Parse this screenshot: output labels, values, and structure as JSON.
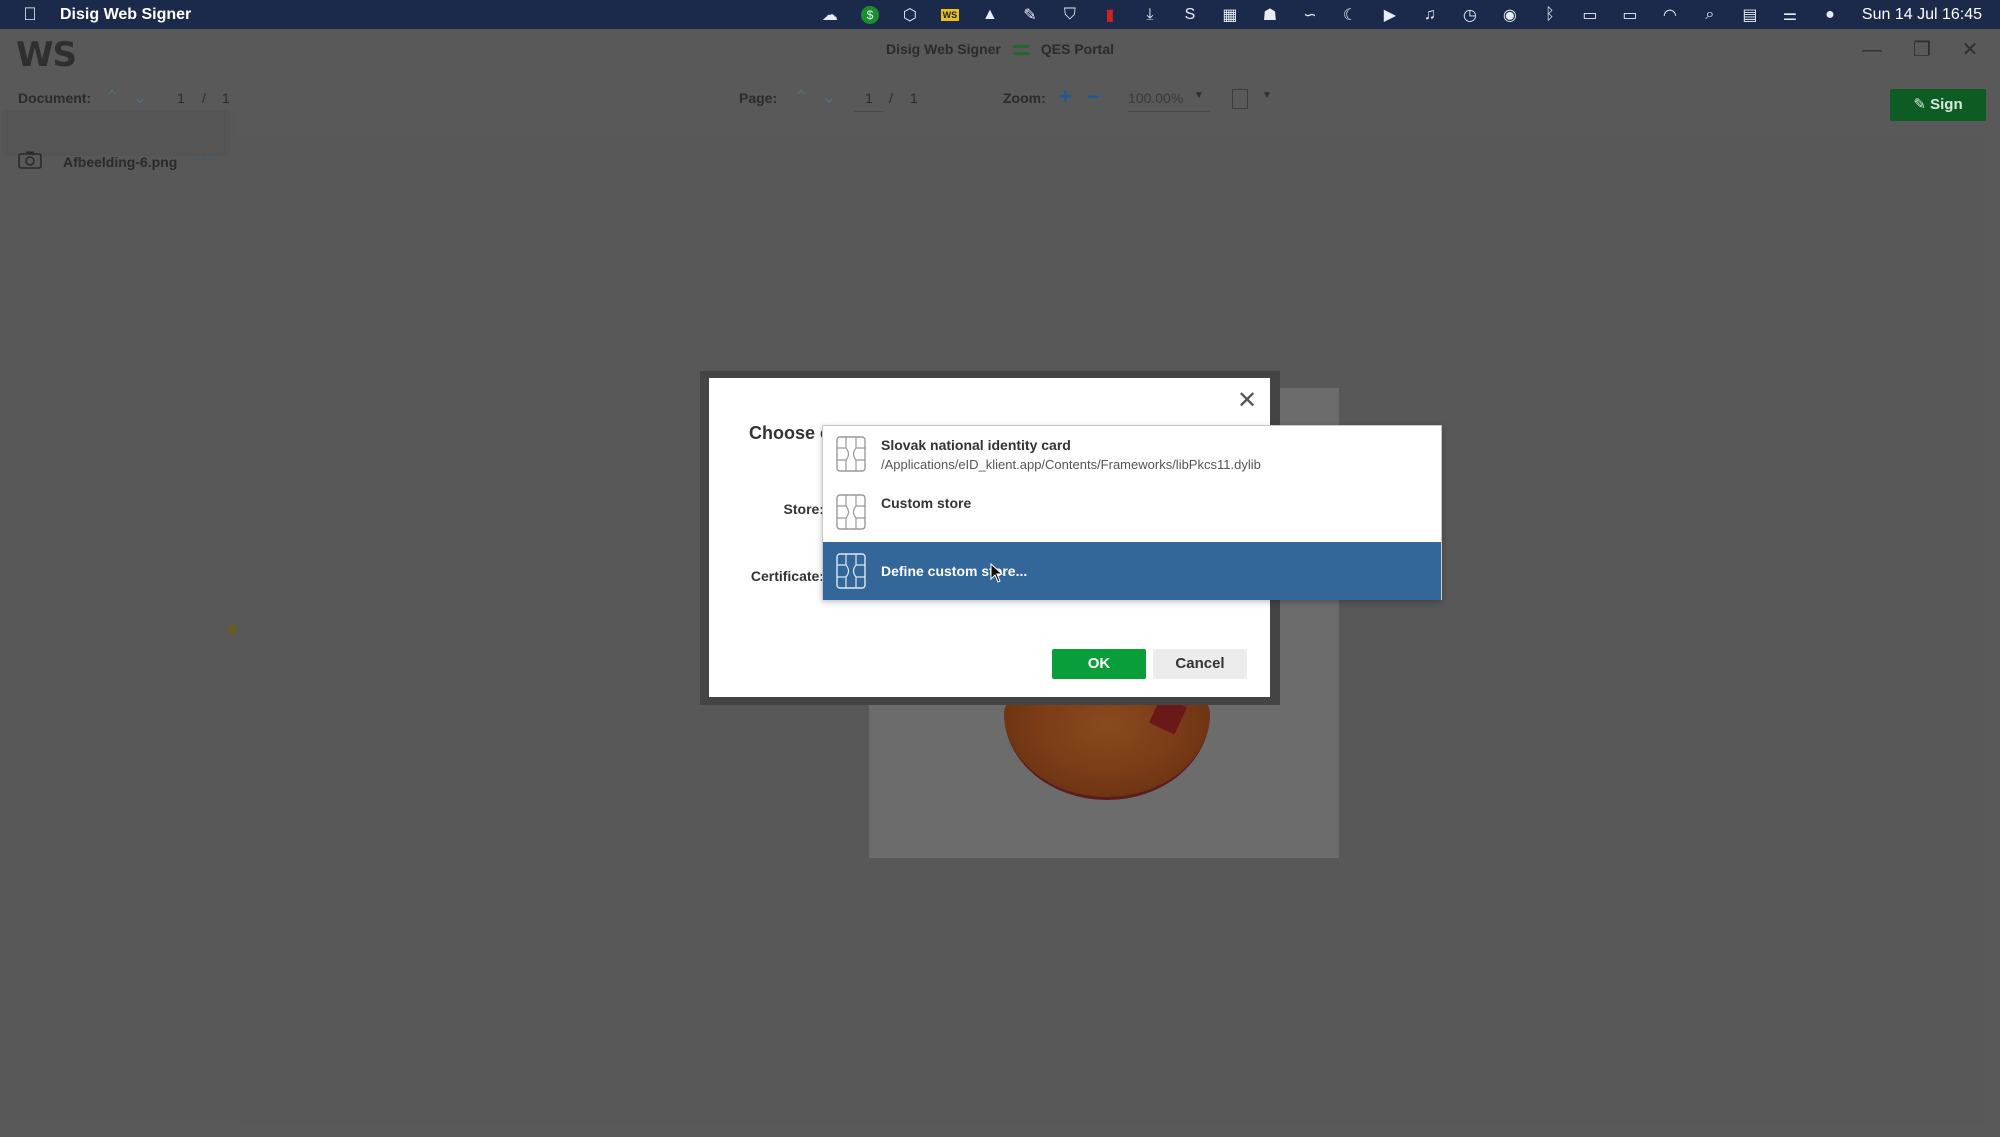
{
  "menubar": {
    "app_name": "Disig Web Signer",
    "clock": "Sun 14 Jul  16:45",
    "tray_icons": [
      "cloud-icon",
      "dollar-icon",
      "box-icon",
      "ws-icon",
      "vlc-icon",
      "pen-icon",
      "shield-icon",
      "book-icon",
      "download-icon",
      "s-icon",
      "grid-icon",
      "hat-icon",
      "signature-icon",
      "moon-icon",
      "play-icon",
      "headphones-icon",
      "history-icon",
      "accessibility-icon",
      "bluetooth-icon",
      "battery-icon",
      "display-icon",
      "wifi-icon",
      "search-icon",
      "keyboard-icon",
      "control-center-icon",
      "siri-icon"
    ]
  },
  "window": {
    "logo": "WS",
    "title_left": "Disig Web Signer",
    "title_right": "QES Portal"
  },
  "toolbar": {
    "document_label": "Document:",
    "document_current": "1",
    "document_sep": "/",
    "document_total": "1",
    "page_label": "Page:",
    "page_current": "1",
    "page_sep": "/",
    "page_total": "1",
    "zoom_label": "Zoom:",
    "zoom_value": "100.00%",
    "sign_label": "Sign"
  },
  "sidebar": {
    "document_name": "Afbeelding-6.png",
    "more": "···"
  },
  "dialog": {
    "title": "Choose c",
    "store_label": "Store:",
    "certificate_label": "Certificate:",
    "ok_label": "OK",
    "cancel_label": "Cancel"
  },
  "dropdown": {
    "items": [
      {
        "name": "Slovak national identity card",
        "path": "/Applications/eID_klient.app/Contents/Frameworks/libPkcs11.dylib"
      },
      {
        "name": "Custom store",
        "path": ""
      },
      {
        "name": "Define custom store...",
        "path": ""
      }
    ],
    "selected_index": 2
  }
}
